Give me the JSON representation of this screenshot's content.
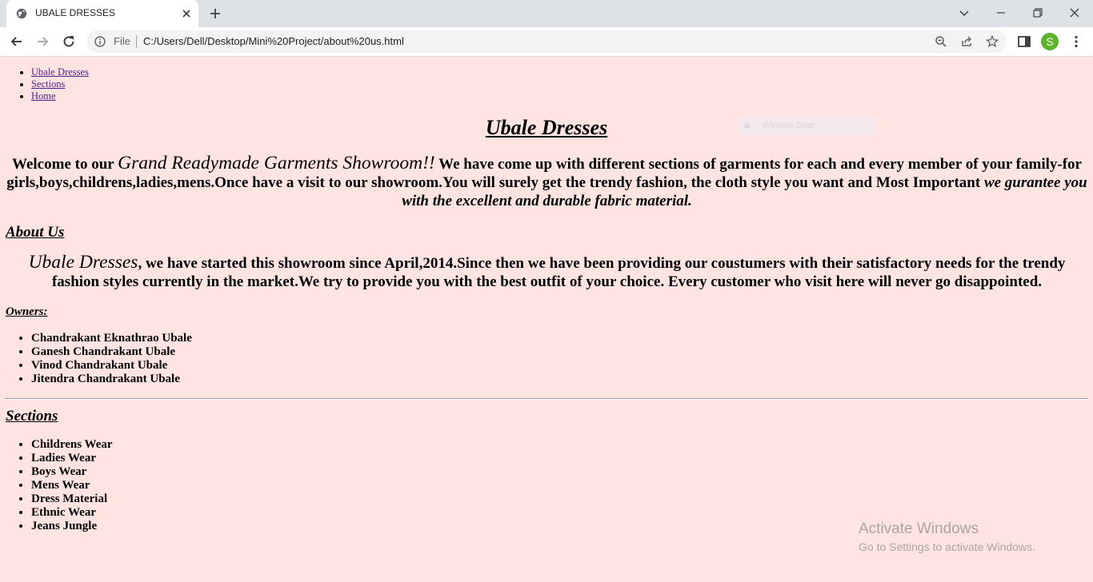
{
  "browser": {
    "tab_title": "UBALE DRESSES",
    "url_scheme": "File",
    "url": "C:/Users/Dell/Desktop/Mini%20Project/about%20us.html",
    "avatar_letter": "S"
  },
  "page": {
    "nav_links": [
      "Ubale Dresses",
      "Sections",
      "Home"
    ],
    "title": "Ubale Dresses",
    "welcome": {
      "lead": "Welcome to our ",
      "showroom": "Grand Readymade Garments Showroom!!",
      "body": " We have come up with different sections of garments for each and every member of your family-for girls,boys,childrens,ladies,mens.Once have a visit to our showroom.You will surely get the trendy fashion, the cloth style you want and Most Important ",
      "guarantee": "we gurantee you with the excellent and durable fabric material."
    },
    "about_heading": "About Us",
    "about": {
      "name": "Ubale Dresses",
      "body": ", we have started this showroom since April,2014.Since then we have been providing our coustumers with their satisfactory needs for the trendy fashion styles currently in the market.We try to provide you with the best outfit of your choice. Every customer who visit here will never go disappointed."
    },
    "owners_heading": "Owners:",
    "owners": [
      "Chandrakant Eknathrao Ubale",
      "Ganesh Chandrakant Ubale",
      "Vinod Chandrakant Ubale",
      "Jitendra Chandrakant Ubale"
    ],
    "sections_heading": "Sections",
    "sections": [
      "Childrens Wear",
      "Ladies Wear",
      "Boys Wear",
      "Mens Wear",
      "Dress Material",
      "Ethnic Wear",
      "Jeans Jungle"
    ]
  },
  "overlay": {
    "window_snip": "Window Snip",
    "activate_title": "Activate Windows",
    "activate_sub": "Go to Settings to activate Windows."
  },
  "colors": {
    "page_bg": "#ffe4e1",
    "link": "#551a8b",
    "avatar": "#5bb327"
  }
}
